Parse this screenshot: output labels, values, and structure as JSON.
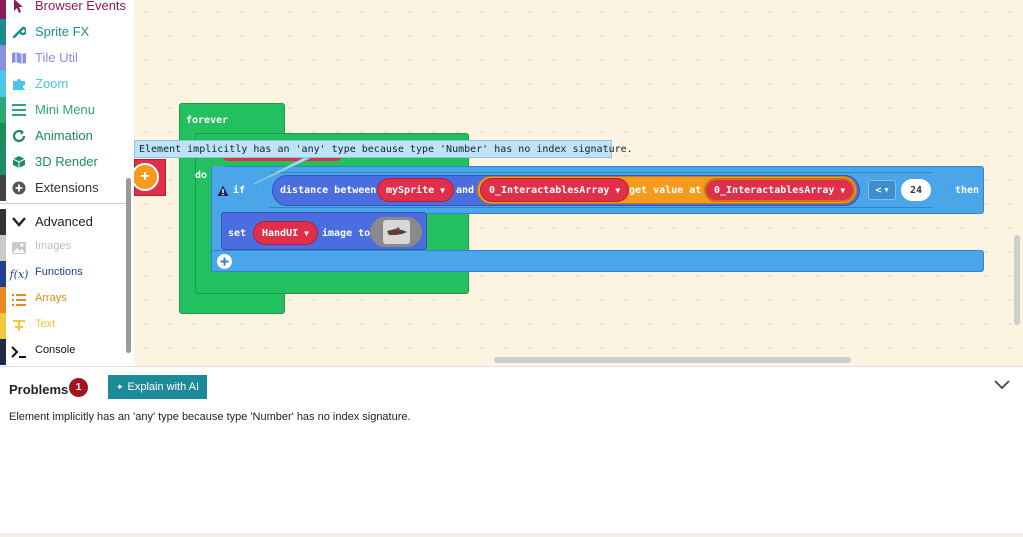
{
  "toolbox": {
    "items": [
      {
        "label": "Browser Events",
        "color": "#8b1b5a",
        "icon": "cursor-icon"
      },
      {
        "label": "Sprite FX",
        "color": "#1e8b8f",
        "icon": "wrench-icon"
      },
      {
        "label": "Tile Util",
        "color": "#8a8fe0",
        "icon": "map-icon"
      },
      {
        "label": "Zoom",
        "color": "#4bc5e8",
        "icon": "puzzle-icon"
      },
      {
        "label": "Mini Menu",
        "color": "#2ea873",
        "icon": "menu-icon"
      },
      {
        "label": "Animation",
        "color": "#1e8c5a",
        "icon": "refresh-icon"
      },
      {
        "label": "3D Render",
        "color": "#1e8c6a",
        "icon": "cube-icon"
      },
      {
        "label": "Extensions",
        "color": "#444444",
        "icon": "plus-circle-icon"
      },
      {
        "label": "Advanced",
        "color": "#333333",
        "icon": "chevron-down-icon"
      },
      {
        "label": "Images",
        "color": "#c9c9c9",
        "icon": "image-icon"
      },
      {
        "label": "Functions",
        "color": "#1f3f8f",
        "icon": "function-icon"
      },
      {
        "label": "Arrays",
        "color": "#e88a1a",
        "icon": "list-icon"
      },
      {
        "label": "Text",
        "color": "#f0c83c",
        "icon": "text-icon"
      },
      {
        "label": "Console",
        "color": "#1f2c44",
        "icon": "terminal-icon"
      }
    ]
  },
  "blocks": {
    "forever_label": "forever",
    "do_label": "do",
    "if_label": "if",
    "distance_label": "distance between",
    "sprite_var": "mySprite",
    "and_label": "and",
    "array_var_1": "0_InteractablesArray",
    "get_value_label": "get value at",
    "array_var_2": "0_InteractablesArray",
    "operator": "<",
    "threshold": "24",
    "then_label": "then",
    "set_label": "set",
    "handui_var": "HandUI",
    "image_to_label": "image to"
  },
  "tooltip": {
    "text": "Element implicitly has an 'any' type because type 'Number' has no index signature."
  },
  "problems": {
    "title": "Problems",
    "count": "1",
    "explain_button": "Explain with AI",
    "message": "Element implicitly has an 'any' type because type 'Number' has no index signature."
  },
  "colors": {
    "workspace_bg": "#fdf3e1",
    "loops_green": "#22c05e",
    "logic_blue": "#4aa6e8",
    "sprite_blue": "#4a6de0",
    "variable_red": "#e03049",
    "array_orange": "#f59a1d",
    "explain_teal": "#1d8a99",
    "badge_red": "#a4141c"
  }
}
